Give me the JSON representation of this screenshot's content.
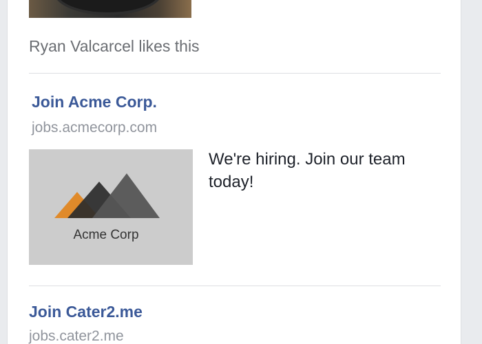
{
  "feed": {
    "likes_text": "Ryan Valcarcel likes this",
    "ads": [
      {
        "title": "Join Acme Corp.",
        "url": "jobs.acmecorp.com",
        "logo_text": "Acme Corp",
        "body": "We're hiring. Join our team today!"
      },
      {
        "title": "Join Cater2.me",
        "url": "jobs.cater2.me"
      }
    ]
  },
  "colors": {
    "link_blue": "#3b5998",
    "muted_gray": "#90949c",
    "logo_orange": "#e08a2a",
    "logo_dark": "#2b2b2b"
  }
}
